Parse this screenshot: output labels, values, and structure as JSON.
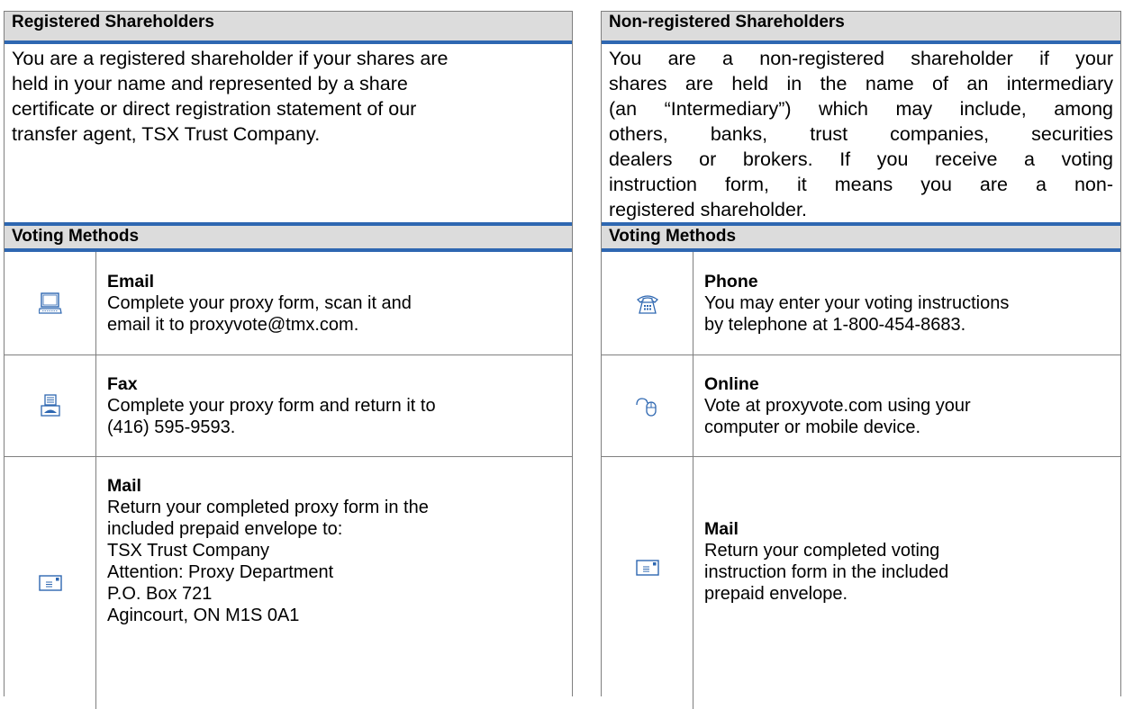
{
  "left": {
    "header": "Registered Shareholders",
    "intro_lines": [
      "You are a registered shareholder if your shares are",
      "held in your name and represented by a share",
      "certificate or direct registration statement of our",
      "transfer agent, TSX Trust Company."
    ],
    "methods_header": "Voting Methods",
    "methods": [
      {
        "icon": "computer-icon",
        "title": "Email",
        "lines": [
          "Complete your proxy form, scan it and",
          "email it to proxyvote@tmx.com."
        ]
      },
      {
        "icon": "fax-icon",
        "title": "Fax",
        "lines": [
          "Complete your proxy form and return it to",
          "(416) 595-9593."
        ]
      },
      {
        "icon": "envelope-icon",
        "title": "Mail",
        "lines": [
          "Return your completed proxy form in the",
          "included prepaid envelope to:",
          "TSX Trust Company",
          "Attention: Proxy Department",
          "P.O. Box 721",
          "Agincourt, ON M1S 0A1"
        ]
      }
    ]
  },
  "right": {
    "header": "Non-registered Shareholders",
    "intro_lines": [
      "You are a non-registered shareholder if your",
      "shares are held in the name of an intermediary",
      "(an “Intermediary”) which may include, among",
      "others, banks, trust companies, securities",
      "dealers or brokers.  If you receive a voting",
      "instruction form, it means you are a non-",
      "registered shareholder."
    ],
    "methods_header": "Voting Methods",
    "methods": [
      {
        "icon": "telephone-icon",
        "title": "Phone",
        "lines": [
          "You may enter your voting instructions",
          "by telephone at 1-800-454-8683."
        ]
      },
      {
        "icon": "mouse-icon",
        "title": "Online",
        "lines": [
          "Vote at proxyvote.com using your",
          "computer or mobile device."
        ]
      },
      {
        "icon": "envelope-icon",
        "title": "Mail",
        "lines": [
          "Return your completed voting",
          "instruction form in the included",
          "prepaid envelope."
        ]
      }
    ]
  },
  "colors": {
    "header_bg": "#dcdcdc",
    "rule": "#2e67b1",
    "icon": "#2e67b1",
    "border": "#7f7f7f"
  }
}
